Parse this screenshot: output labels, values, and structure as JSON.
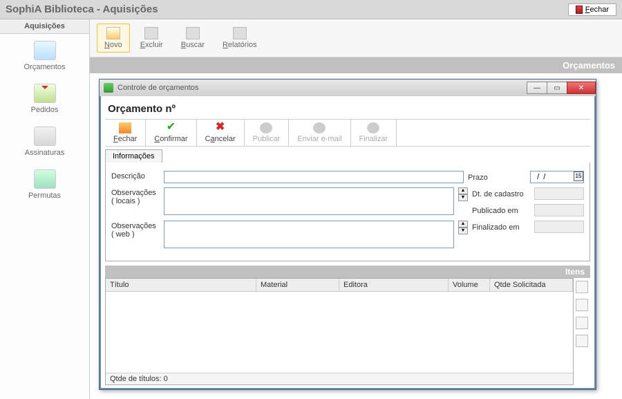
{
  "app": {
    "title": "SophiA Biblioteca - Aquisições",
    "close_label": "Fechar"
  },
  "sidebar": {
    "title": "Aquisições",
    "items": [
      {
        "label": "Orçamentos"
      },
      {
        "label": "Pedidos"
      },
      {
        "label": "Assinaturas"
      },
      {
        "label": "Permutas"
      }
    ]
  },
  "toolbar": {
    "novo": "Novo",
    "excluir": "Excluir",
    "buscar": "Buscar",
    "relatorios": "Relatórios"
  },
  "section_band": "Orçamentos",
  "modal": {
    "title": "Controle de orçamentos",
    "heading": "Orçamento nº",
    "buttons": {
      "fechar": "Fechar",
      "confirmar": "Confirmar",
      "cancelar": "Cancelar",
      "publicar": "Publicar",
      "enviar_email": "Enviar e-mail",
      "finalizar": "Finalizar"
    },
    "tab": "Informações",
    "fields": {
      "descricao_label": "Descrição",
      "descricao_value": "",
      "obs_local_label": "Observações ( locais )",
      "obs_local_value": "",
      "obs_web_label": "Observações ( web )",
      "obs_web_value": "",
      "prazo_label": "Prazo",
      "prazo_value": "  /  /",
      "dt_cadastro_label": "Dt. de cadastro",
      "publicado_em_label": "Publicado em",
      "finalizado_em_label": "Finalizado em"
    },
    "items": {
      "band": "Itens",
      "columns": {
        "titulo": "Título",
        "material": "Material",
        "editora": "Editora",
        "volume": "Volume",
        "qtde": "Qtde Solicitada"
      },
      "footer": "Qtde de títulos: 0"
    }
  }
}
